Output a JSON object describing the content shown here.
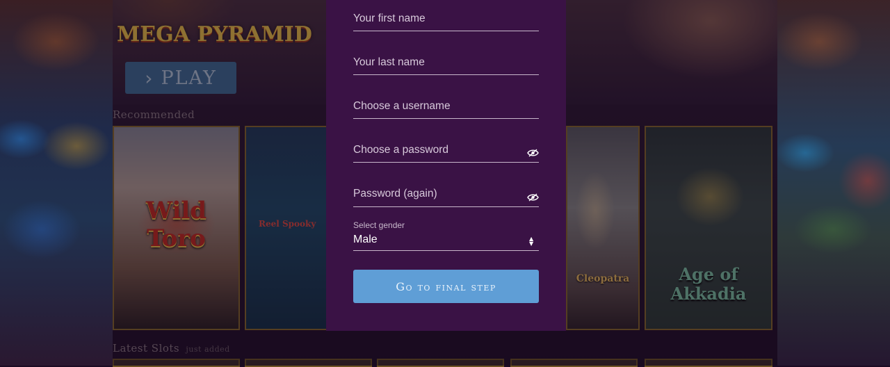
{
  "background": {
    "logo_text": "MEGA PYRAMID",
    "play_label": "PLAY",
    "recommended_label": "Recommended",
    "latest_label": "Latest Slots",
    "latest_sub": "just added",
    "games": [
      {
        "title": "Wild Toro"
      },
      {
        "title": "Reel Spooky"
      },
      {
        "title": "Cleopatra"
      },
      {
        "title": "Age of Akkadia"
      }
    ]
  },
  "form": {
    "first_name_placeholder": "Your first name",
    "last_name_placeholder": "Your last name",
    "username_placeholder": "Choose a username",
    "password_placeholder": "Choose a password",
    "password_again_placeholder": "Password (again)",
    "gender_label": "Select gender",
    "gender_value": "Male",
    "submit_label": "Go to final step"
  },
  "colors": {
    "modal_bg": "#3a1245",
    "button_bg": "#5f9ed6",
    "accent_gold": "#f3c74a"
  },
  "icons": {
    "password_toggle": "eye-slash-icon",
    "select_arrows": "updown-arrows-icon",
    "play_chevron": "chevron-right-icon"
  }
}
